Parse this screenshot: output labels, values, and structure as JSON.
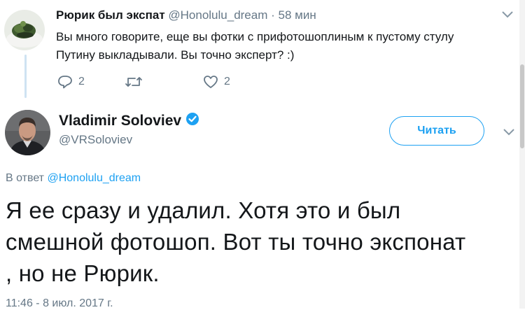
{
  "reply_tweet": {
    "author_name": "Рюрик был экспат",
    "author_handle": "@Honolulu_dream",
    "separator": "·",
    "time": "58 мин",
    "text_line1": "Вы много говорите, еще вы фотки с прифотошоплиным к пустому стулу",
    "text_line2": "Путину выкладывали. Вы точно эксперт? :)",
    "actions": {
      "reply_count": "2",
      "retweet_count": "",
      "like_count": "2"
    }
  },
  "main_tweet": {
    "author_name": "Vladimir Soloviev",
    "author_handle": "@VRSoloviev",
    "follow_label": "Читать",
    "in_reply_prefix": "В ответ",
    "in_reply_handle": "@Honolulu_dream",
    "text_line1": "Я ее сразу и удалил. Хотя это и был",
    "text_line2": "смешной фотошоп. Вот ты точно экспонат",
    "text_line3": ", но не Рюрик.",
    "timestamp": "11:46 - 8 июл. 2017 г."
  },
  "colors": {
    "accent": "#1da1f2",
    "secondary_text": "#657786",
    "primary_text": "#14171a",
    "thread_line": "#cfe3f2"
  },
  "icons": [
    "reply-icon",
    "retweet-icon",
    "like-icon",
    "verified-badge-icon",
    "chevron-down-icon"
  ]
}
